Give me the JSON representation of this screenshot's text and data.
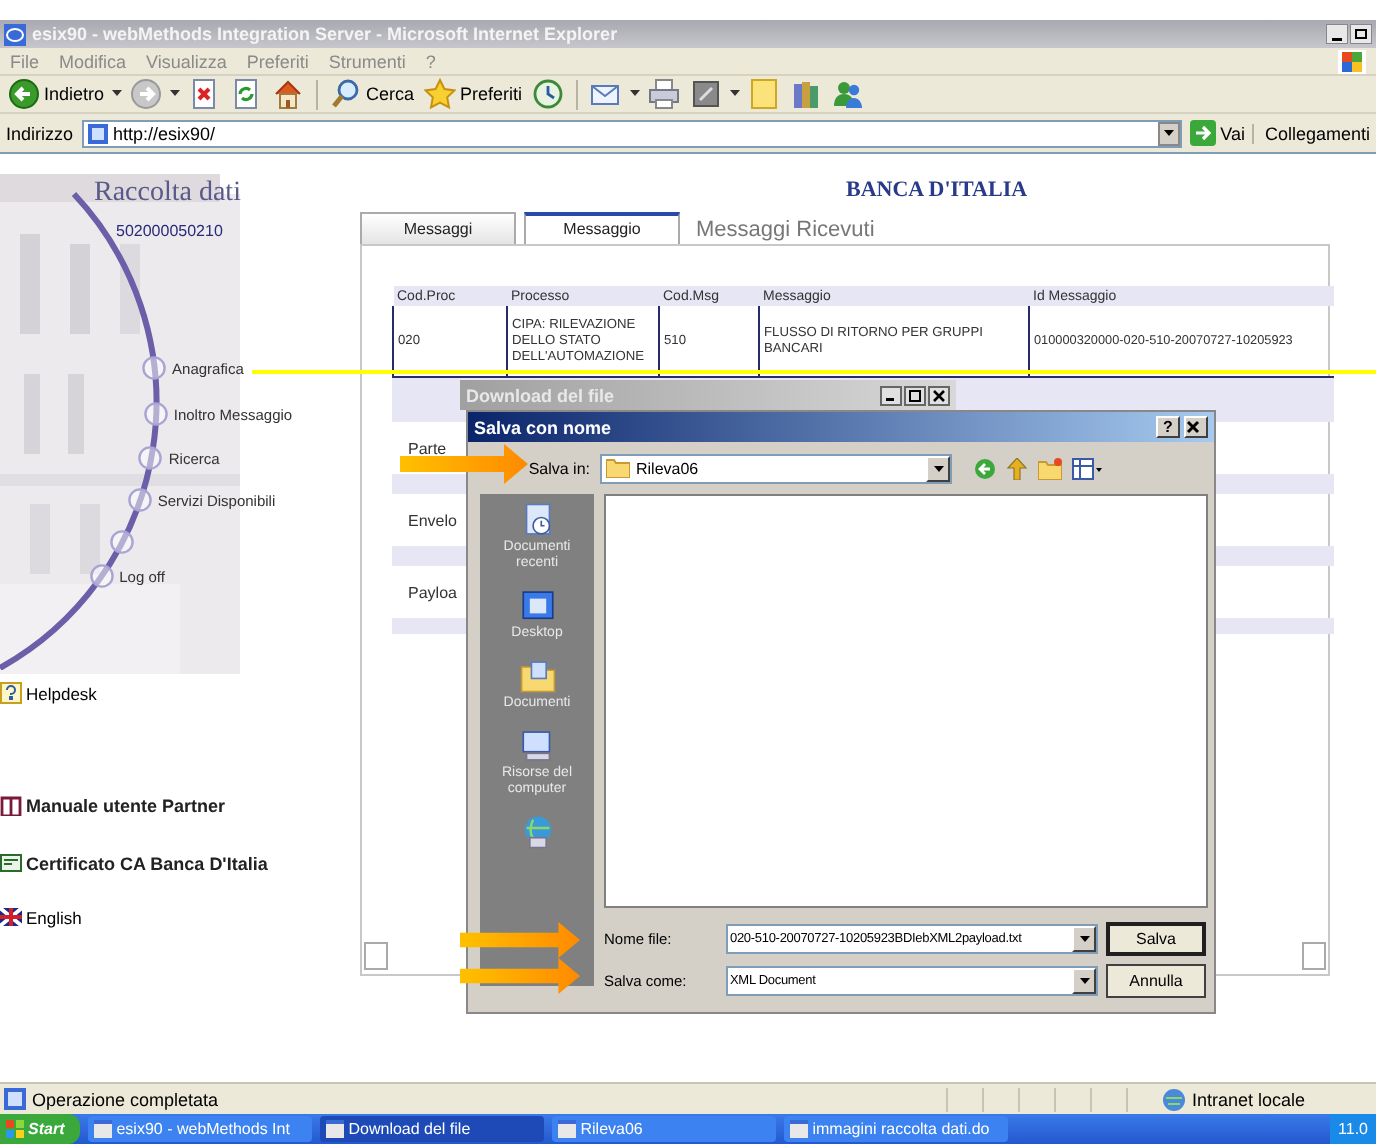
{
  "window": {
    "title": "esix90 - webMethods Integration Server - Microsoft Internet Explorer"
  },
  "menu": [
    "File",
    "Modifica",
    "Visualizza",
    "Preferiti",
    "Strumenti",
    "?"
  ],
  "toolbar": [
    {
      "kind": "back",
      "label": "Indietro"
    },
    {
      "kind": "forward"
    },
    {
      "kind": "stop"
    },
    {
      "kind": "refresh"
    },
    {
      "kind": "home"
    },
    {
      "kind": "search",
      "label": "Cerca"
    },
    {
      "kind": "favorites",
      "label": "Preferiti"
    },
    {
      "kind": "history"
    },
    {
      "kind": "mail"
    },
    {
      "kind": "print"
    },
    {
      "kind": "edit"
    },
    {
      "kind": "note"
    },
    {
      "kind": "research"
    },
    {
      "kind": "messenger"
    }
  ],
  "address_bar": {
    "label": "Indirizzo",
    "value": "http://esix90/",
    "go": "Vai",
    "links": "Collegamenti"
  },
  "sidebar": {
    "title": "Raccolta dati",
    "code": "502000050210",
    "nav": [
      "Anagrafica",
      "Inoltro Messaggio",
      "Ricerca",
      "Servizi Disponibili",
      "Log off"
    ],
    "links": [
      {
        "kind": "help",
        "label": "Helpdesk"
      },
      {
        "kind": "manual",
        "label": "Manuale utente Partner"
      },
      {
        "kind": "certificate",
        "label": "Certificato CA Banca D'Italia"
      },
      {
        "kind": "flag",
        "label": "English"
      }
    ]
  },
  "header": "BANCA D'ITALIA",
  "tabs": [
    {
      "label": "Messaggi",
      "kind": "tab",
      "selected": false
    },
    {
      "label": "Messaggio",
      "kind": "tab",
      "selected": true
    },
    {
      "label": "Messaggi Ricevuti",
      "kind": "link",
      "selected": false
    }
  ],
  "table": {
    "columns": [
      "Cod.Proc",
      "Processo",
      "Cod.Msg",
      "Messaggio",
      "Id Messaggio"
    ],
    "rows": [
      [
        "020",
        "CIPA: RILEVAZIONE DELLO STATO DELL'AUTOMAZIONE",
        "510",
        "FLUSSO DI RITORNO PER GRUPPI BANCARI",
        "010000320000-020-510-20070727-10205923"
      ]
    ]
  },
  "details": [
    "Parte",
    "Envelo",
    "Payloa"
  ],
  "download_window": {
    "title": "Download del file"
  },
  "save_dialog": {
    "title": "Salva con nome",
    "help": "?",
    "save_in_label": "Salva in:",
    "folder": "Rileva06",
    "places": [
      {
        "kind": "recent",
        "label": "Documenti recenti"
      },
      {
        "kind": "desktop",
        "label": "Desktop"
      },
      {
        "kind": "documents",
        "label": "Documenti"
      },
      {
        "kind": "computer",
        "label": "Risorse del computer"
      },
      {
        "kind": "network"
      }
    ],
    "filename_label": "Nome file:",
    "filename": "020-510-20070727-10205923BDIebXML2payload.txt",
    "type_label": "Salva come:",
    "type": "XML Document",
    "buttons": [
      "Salva",
      "Annulla"
    ]
  },
  "status_bar": {
    "text": "Operazione completata",
    "zone": "Intranet locale"
  },
  "taskbar": {
    "start": "Start",
    "items": [
      "esix90 - webMethods Int",
      "Download del file",
      "Rileva06",
      "immagini raccolta dati.do"
    ],
    "clock": "11.0"
  }
}
